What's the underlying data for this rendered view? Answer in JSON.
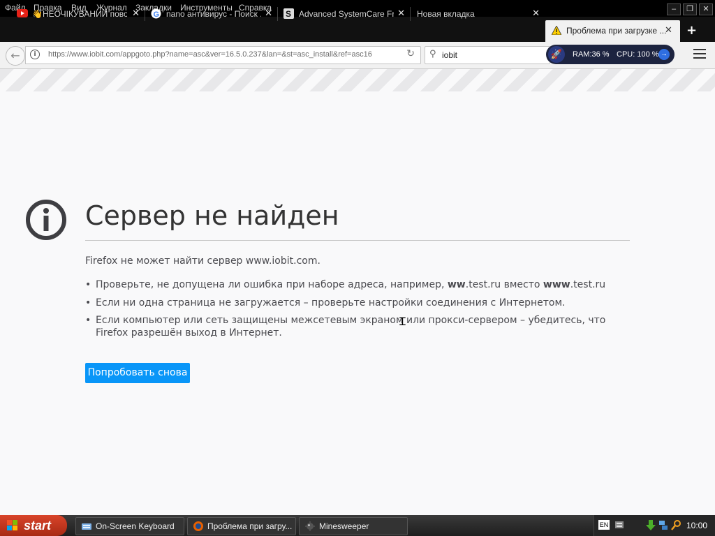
{
  "menubar": {
    "items": [
      "Файл",
      "Правка",
      "Вид",
      "Журнал",
      "Закладки",
      "Инструменты",
      "Справка"
    ]
  },
  "tabs": [
    {
      "title": "👋НЕОЧІКУВАНИЙ повор...",
      "icon": "youtube-icon"
    },
    {
      "title": "nano антивирус - Поиск ...",
      "icon": "google-icon"
    },
    {
      "title": "Advanced SystemCare Fr...",
      "icon": "iobit-s-icon"
    },
    {
      "title": "Новая вкладка",
      "icon": ""
    },
    {
      "title": "Проблема при загрузке ...",
      "icon": "warning-icon",
      "active": true
    }
  ],
  "navbar": {
    "url": "https://www.iobit.com/appgoto.php?name=asc&ver=16.5.0.237&lan=&st=asc_install&ref=asc16",
    "search_value": "iobit"
  },
  "widget": {
    "ram": "RAM:36 %",
    "cpu": "CPU: 100 %"
  },
  "error": {
    "title": "Сервер не найден",
    "description": "Firefox не может найти сервер www.iobit.com.",
    "bullet1_pre": "Проверьте, не допущена ли ошибка при наборе адреса, например, ",
    "bullet1_b1": "ww",
    "bullet1_mid1": ".test.ru вместо ",
    "bullet1_b2": "www",
    "bullet1_end": ".test.ru",
    "bullet2": "Если ни одна страница не загружается – проверьте настройки соединения с Интернетом.",
    "bullet3": "Если компьютер или сеть защищены межсетевым экраном или прокси-сервером – убедитесь, что Firefox разрешён выход в Интернет.",
    "try_again": "Попробовать снова"
  },
  "taskbar": {
    "start": "start",
    "tasks": [
      "On-Screen Keyboard",
      "Проблема при загру...",
      "Minesweeper"
    ],
    "lang": "EN",
    "clock": "10:00"
  },
  "colors": {
    "accent": "#0996f8",
    "start": "#c0361e"
  }
}
